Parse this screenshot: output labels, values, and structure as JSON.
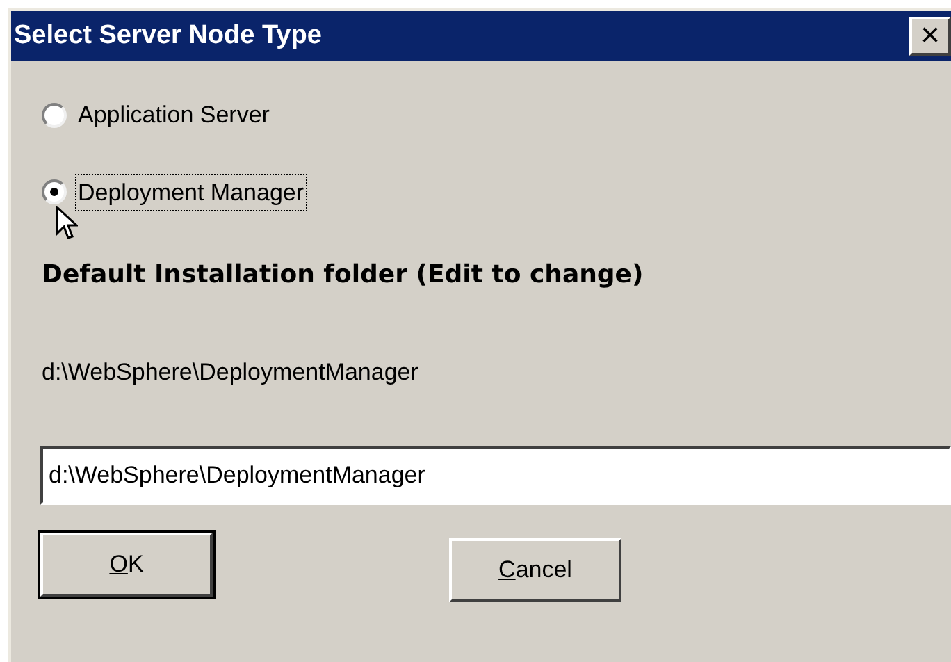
{
  "window": {
    "title": "Select Server Node Type",
    "close": "×"
  },
  "options": [
    {
      "label": "Application Server",
      "selected": false,
      "focused": false
    },
    {
      "label": "Deployment Manager",
      "selected": true,
      "focused": true
    }
  ],
  "heading": "Default Installation folder (Edit to change)",
  "default_path": "d:\\WebSphere\\DeploymentManager",
  "folder_field": {
    "value": "d:\\WebSphere\\DeploymentManager"
  },
  "buttons": [
    {
      "mnemonic": "O",
      "rest": "K",
      "default": true
    },
    {
      "mnemonic": "C",
      "rest": "ancel",
      "default": false
    }
  ]
}
